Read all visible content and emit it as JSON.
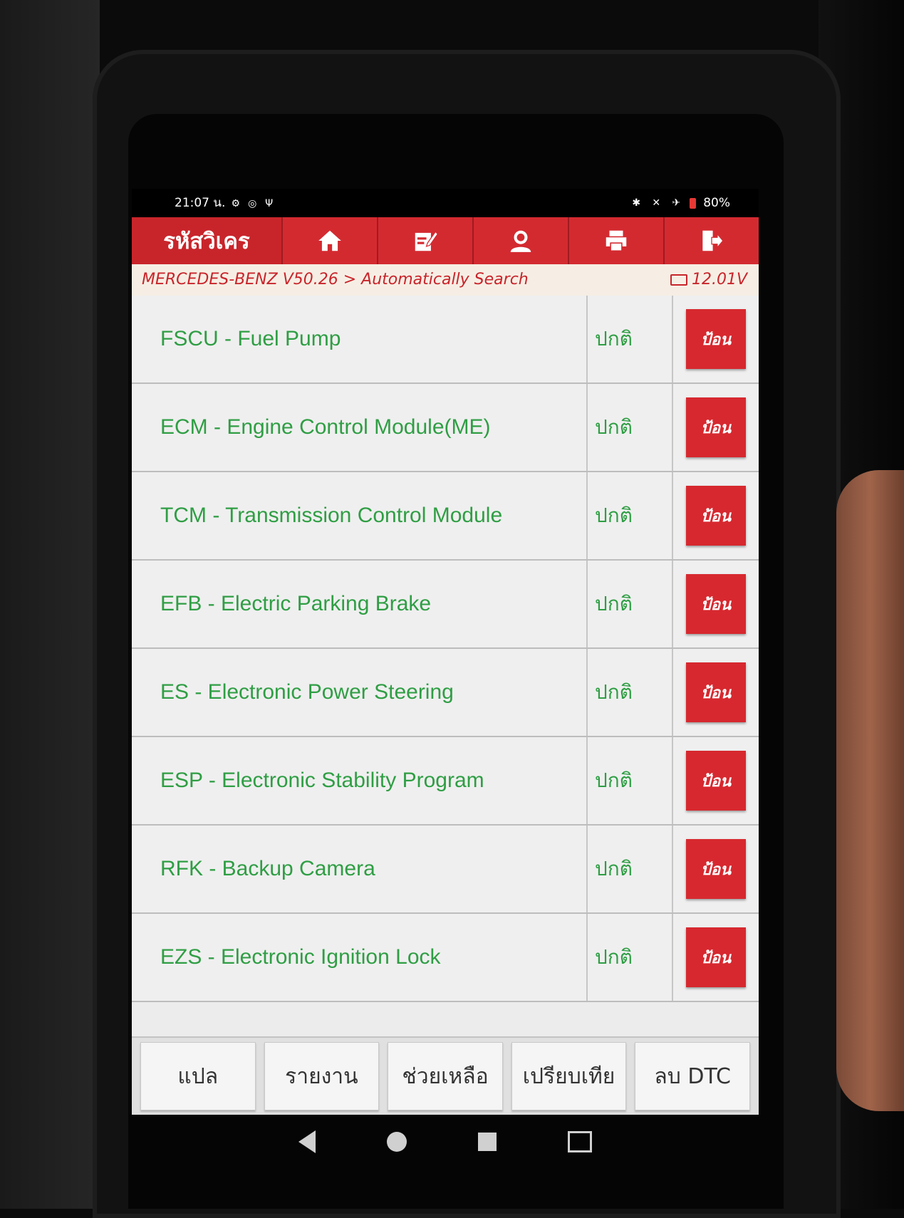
{
  "status_bar": {
    "time": "21:07 น.",
    "battery": "80%"
  },
  "header": {
    "brand": "รหัสวิเคร",
    "buttons": [
      {
        "icon": "home-icon"
      },
      {
        "icon": "edit-icon"
      },
      {
        "icon": "user-icon"
      },
      {
        "icon": "print-icon"
      },
      {
        "icon": "exit-icon"
      }
    ]
  },
  "breadcrumb": {
    "path": "MERCEDES-BENZ V50.26 > Automatically Search",
    "voltage": "12.01V"
  },
  "modules": [
    {
      "name": "FSCU - Fuel Pump",
      "status": "ปกติ",
      "action": "ป้อน"
    },
    {
      "name": "ECM - Engine Control Module(ME)",
      "status": "ปกติ",
      "action": "ป้อน"
    },
    {
      "name": "TCM - Transmission Control Module",
      "status": "ปกติ",
      "action": "ป้อน"
    },
    {
      "name": "EFB - Electric Parking Brake",
      "status": "ปกติ",
      "action": "ป้อน"
    },
    {
      "name": "ES - Electronic Power Steering",
      "status": "ปกติ",
      "action": "ป้อน"
    },
    {
      "name": "ESP - Electronic Stability Program",
      "status": "ปกติ",
      "action": "ป้อน"
    },
    {
      "name": "RFK - Backup Camera",
      "status": "ปกติ",
      "action": "ป้อน"
    },
    {
      "name": "EZS - Electronic Ignition Lock",
      "status": "ปกติ",
      "action": "ป้อน"
    }
  ],
  "footer": {
    "translate": "แปล",
    "report": "รายงาน",
    "help": "ช่วยเหลือ",
    "compare": "เปรียบเทีย",
    "clear_dtc": "ลบ DTC"
  },
  "colors": {
    "accent": "#c8252b",
    "ok_text": "#2f9e44"
  }
}
